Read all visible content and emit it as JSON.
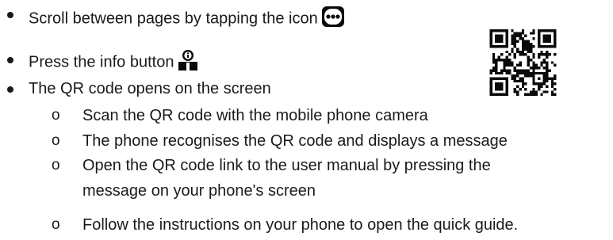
{
  "bullets": [
    {
      "text": "Scroll between pages by tapping the icon"
    },
    {
      "text": "Press the info button"
    },
    {
      "text": "The QR code opens on the screen"
    }
  ],
  "sub_bullets": [
    {
      "marker": "o",
      "text": "Scan the QR code with the mobile phone camera"
    },
    {
      "marker": "o",
      "text": "The phone recognises the QR code and displays a message"
    },
    {
      "marker": "o",
      "text": "Open the QR code link to the user manual by pressing the"
    },
    {
      "marker": "",
      "text": "message on your phone's screen"
    },
    {
      "marker": "o",
      "text": "Follow the instructions on your phone to open the quick guide."
    }
  ],
  "icons": {
    "more": "more-dots-icon",
    "info": "info-button-icon",
    "qr": "qr-code"
  },
  "colors": {
    "text": "#1a1a1a",
    "icon_bg": "#0a0a0a"
  }
}
